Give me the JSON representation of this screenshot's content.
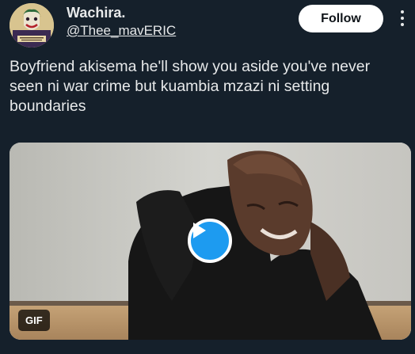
{
  "author": {
    "display_name": "Wachira.",
    "handle": "@Thee_mavERIC",
    "avatar_icon": "joker-avatar-icon"
  },
  "actions": {
    "follow_label": "Follow",
    "more_icon": "more-vertical-icon"
  },
  "tweet": {
    "text": "Boyfriend akisema he'll show you aside you've never seen ni war crime but kuambia mzazi ni setting boundaries"
  },
  "media": {
    "badge": "GIF",
    "play_icon": "play-icon"
  },
  "colors": {
    "background": "#15202b",
    "text": "#e7e9ea",
    "accent": "#1d9bf0",
    "follow_bg": "#ffffff"
  }
}
